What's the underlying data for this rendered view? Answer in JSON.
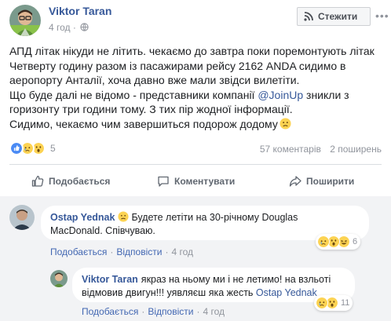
{
  "post": {
    "author": "Viktor Taran",
    "time": "4 год",
    "follow_label": "Стежити",
    "more_label": "•••",
    "body_lines": [
      "АПД літак нікуди не літить. чекаємо до завтра поки поремонтують літак",
      "Четверту годину разом із пасажирами рейсу 2162 ANDA сидимо в",
      "аеропорту Анталії, хоча давно вже мали звідси вилетіти.",
      "Що буде далі не відомо - представники компанії ",
      "горизонту три години тому. З тих пір жодної інформації.",
      "Сидимо, чекаємо чим завершиться подорож додому"
    ],
    "mention": "@JoinUp",
    "line4_tail": " зникли з",
    "reactions_count": "5",
    "comments_count": "57 коментарів",
    "shares_count": "2 поширень"
  },
  "actions": {
    "like": "Подобається",
    "comment": "Коментувати",
    "share": "Поширити"
  },
  "comments": [
    {
      "author": "Ostap Yednak",
      "text_line1": "Будете летіти на 30-річному Douglas",
      "text_line2": "MacDonald. Співчуваю.",
      "like": "Подобається",
      "reply": "Відповісти",
      "time": "4 год",
      "reacts": "6"
    },
    {
      "author": "Viktor Taran",
      "text_line1": "якраз на ньому ми і не летимо! на взльоті",
      "text_line2_a": "відмовив двигун!!! уявляєш яка жесть ",
      "mention": "Ostap Yednak",
      "like": "Подобається",
      "reply": "Відповісти",
      "time": "4 год",
      "reacts": "11"
    }
  ],
  "colors": {
    "link": "#365899",
    "muted": "#90949c",
    "like_blue": "#4267b2",
    "reaction_yellow": "#fcd353"
  }
}
